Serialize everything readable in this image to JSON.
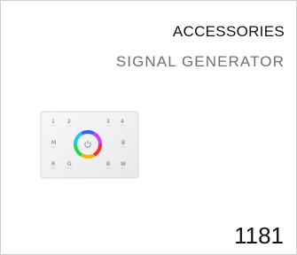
{
  "card": {
    "category": "ACCESSORIES",
    "subtitle": "SIGNAL GENERATOR",
    "number": "1181",
    "image": {
      "icon": "touch-panel-controller-image",
      "panel_color": "#f2f3f4",
      "button_labels": [
        "1",
        "2",
        "3",
        "4",
        "M",
        "B",
        "R",
        "G",
        "B",
        "W"
      ]
    }
  }
}
